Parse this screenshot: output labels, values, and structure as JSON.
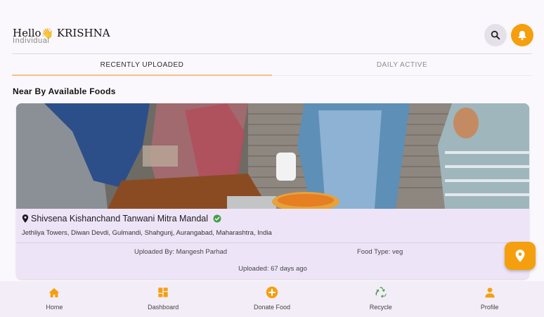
{
  "header": {
    "greeting": "Hello",
    "wave_emoji": "👋",
    "user_name": "KRISHNA",
    "role": "Individual",
    "search_icon": "search-icon",
    "notification_icon": "bell-icon",
    "accent_color": "#f59f0f"
  },
  "tabs": [
    {
      "label": "RECENTLY UPLOADED",
      "active": true
    },
    {
      "label": "DAILY ACTIVE",
      "active": false
    }
  ],
  "section_title": "Near By Available Foods",
  "food_card": {
    "image_icon": "food-distribution-photo",
    "place_name": "Shivsena Kishanchand Tanwani Mitra Mandal",
    "verified_icon": "verified-check-icon",
    "address": "Jethliya Towers, Diwan Devdi, Gulmandi, Shahgunj, Aurangabad, Maharashtra, India",
    "uploaded_by": "Uploaded By: Mangesh Parhad",
    "food_type": "Food Type: veg",
    "uploaded_age": "Uploaded: 67 days ago"
  },
  "fab_icon": "location-pin-icon",
  "bottom_nav": [
    {
      "label": "Home",
      "icon": "home-icon"
    },
    {
      "label": "Dashboard",
      "icon": "dashboard-icon"
    },
    {
      "label": "Donate Food",
      "icon": "add-circle-icon"
    },
    {
      "label": "Recycle",
      "icon": "recycle-icon"
    },
    {
      "label": "Profile",
      "icon": "person-icon"
    }
  ]
}
